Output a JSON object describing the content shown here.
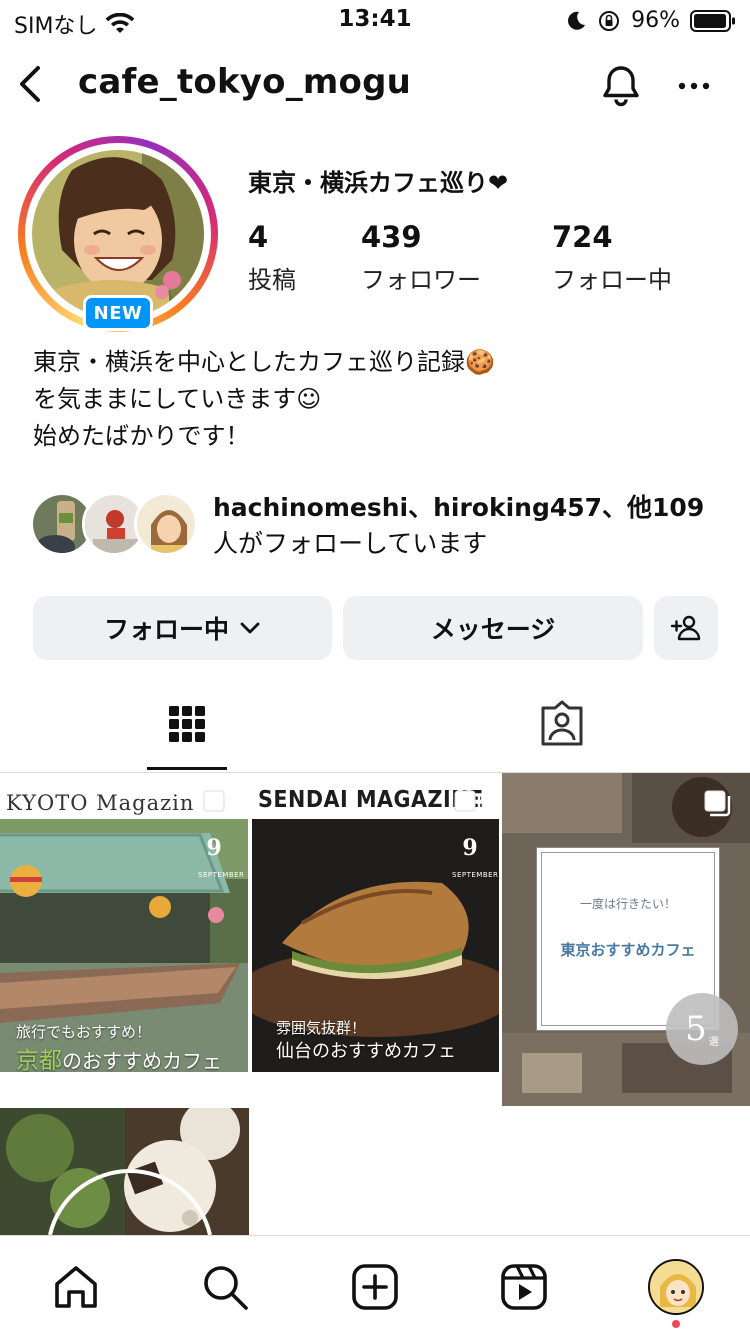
{
  "status_bar": {
    "carrier": "SIMなし",
    "time": "13:41",
    "battery": "96%"
  },
  "header": {
    "username": "cafe_tokyo_mogu"
  },
  "profile": {
    "badge": "NEW",
    "name": "東京・横浜カフェ巡り❤",
    "stats": [
      {
        "value": "4",
        "label": "投稿"
      },
      {
        "value": "439",
        "label": "フォロワー"
      },
      {
        "value": "724",
        "label": "フォロー中"
      }
    ],
    "bio_lines": [
      "東京・横浜を中心としたカフェ巡り記録🍪",
      "を気ままにしていきます☺",
      "始めたばかりです！"
    ],
    "followed_by": {
      "names": "hachinomeshi、hiroking457、他109",
      "rest": "人がフォローしています"
    }
  },
  "buttons": {
    "following": "フォロー中",
    "message": "メッセージ"
  },
  "posts": {
    "kyoto": {
      "title": "KYOTO Magazin",
      "num": "9",
      "month": "SEPTEMBER",
      "caption_small": "旅行でもおすすめ！",
      "caption_highlight": "京都",
      "caption_rest": "のおすすめカフェ"
    },
    "sendai": {
      "title": "SENDAI MAGAZINE",
      "num": "9",
      "month": "SEPTEMBER",
      "caption_small": "雰囲気抜群！",
      "caption_big": "仙台のおすすめカフェ"
    },
    "tokyo": {
      "sub": "一度は行きたい！",
      "main": "東京おすすめカフェ",
      "count": "5",
      "count_unit": "選"
    }
  },
  "colors": {
    "accent_blue": "#0095f6",
    "button_bg": "#eff0f3",
    "notification_dot": "#ed4956"
  }
}
